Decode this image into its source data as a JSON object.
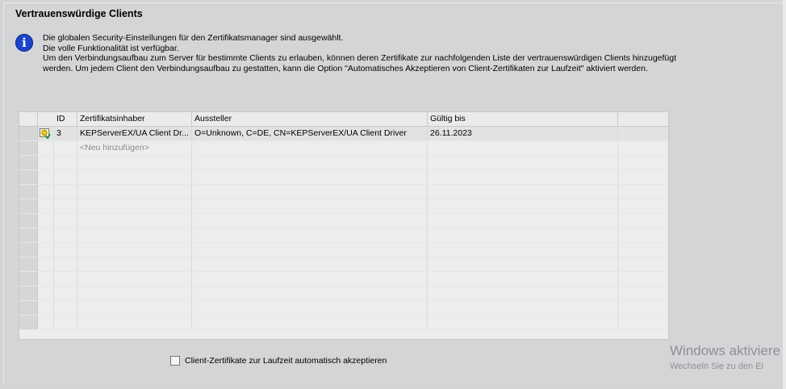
{
  "section": {
    "title": "Vertrauenswürdige Clients"
  },
  "info": {
    "lines": [
      "Die globalen Security-Einstellungen für den Zertifikatsmanager sind ausgewählt.",
      "Die volle Funktionalität ist verfügbar.",
      "Um den Verbindungsaufbau zum Server für bestimmte Clients zu erlauben, können deren Zertifikate zur nachfolgenden Liste der vertrauenswürdigen Clients hinzugefügt",
      "werden. Um jedem Client den Verbindungsaufbau zu gestatten, kann die Option \"Automatisches Akzeptieren von Client-Zertifikaten zur Laufzeit\" aktiviert werden."
    ]
  },
  "table": {
    "columns": [
      "ID",
      "Zertifikatsinhaber",
      "Aussteller",
      "Gültig bis"
    ],
    "rows": [
      {
        "id": "3",
        "owner": "KEPServerEX/UA Client Dr...",
        "issuer": "O=Unknown, C=DE, CN=KEPServerEX/UA Client Driver",
        "valid_until": "26.11.2023",
        "icon": "certificate-icon"
      }
    ],
    "add_row_placeholder": "<Neu hinzufügen>"
  },
  "auto_accept": {
    "label": "Client-Zertifikate zur Laufzeit automatisch akzeptieren",
    "checked": false
  },
  "watermark": {
    "line1": "Windows aktiviere",
    "line2": "Wechseln Sie zu den Ei"
  },
  "colors": {
    "info_icon": "#1b44c8",
    "panel_bg": "#d4d5d7",
    "grid_bg": "#eceded"
  }
}
